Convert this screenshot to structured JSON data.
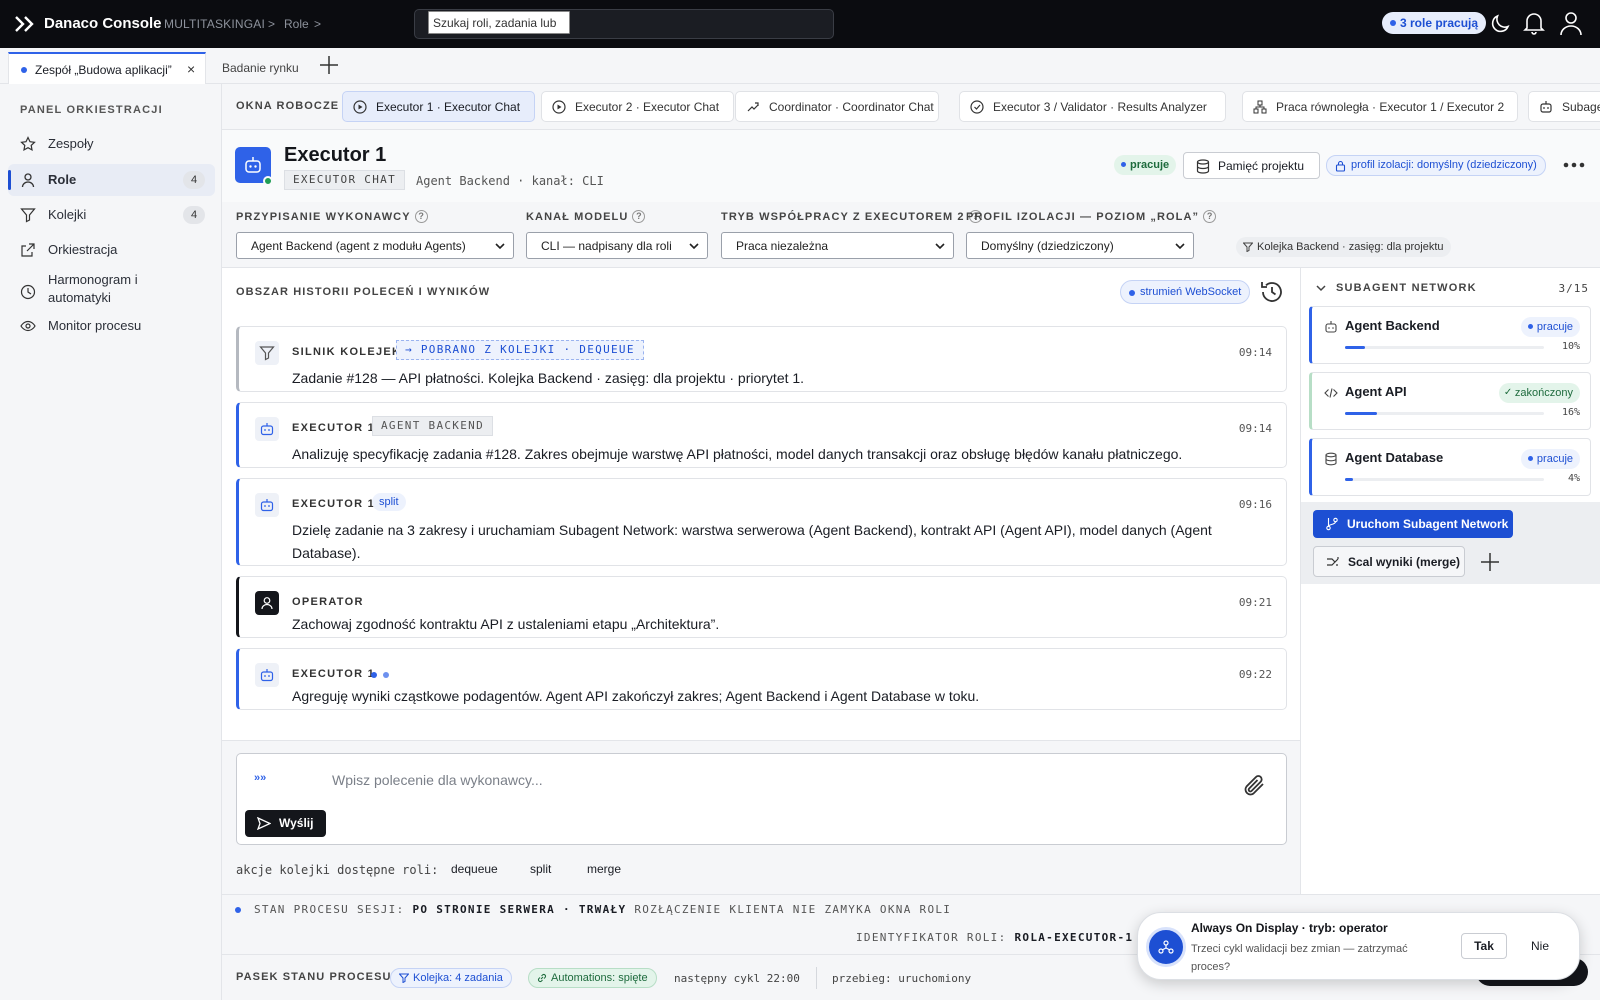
{
  "topbar": {
    "brand": "Danaco Console",
    "breadcrumb": [
      "MULTITASKINGAI",
      "Role"
    ],
    "breadcrumb_sep": ">",
    "search_value": "Szukaj roli, zadania lub",
    "roles_working": "3 role pracują"
  },
  "tabs": [
    {
      "label": "Zespół „Budowa aplikacji”",
      "active": true,
      "close": "×"
    },
    {
      "label": "Badanie rynku",
      "active": false
    }
  ],
  "sidebar": {
    "title": "PANEL ORKIESTRACJI",
    "items": [
      {
        "label": "Zespoły",
        "icon": "star-icon"
      },
      {
        "label": "Role",
        "icon": "user-icon",
        "badge": "4",
        "active": true
      },
      {
        "label": "Kolejki",
        "icon": "filter-icon",
        "badge": "4"
      },
      {
        "label": "Orkiestracja",
        "icon": "external-link-icon"
      },
      {
        "label": "Harmonogram i automatyki",
        "icon": "clock-icon"
      },
      {
        "label": "Monitor procesu",
        "icon": "eye-icon"
      }
    ]
  },
  "work_windows": {
    "title": "OKNA ROBOCZE",
    "items": [
      {
        "label": "Executor 1 · Executor Chat",
        "icon": "play-circle-icon",
        "active": true
      },
      {
        "label": "Executor 2 · Executor Chat",
        "icon": "play-circle-icon"
      },
      {
        "label": "Coordinator · Coordinator Chat",
        "icon": "route-icon"
      },
      {
        "label": "Executor 3 / Validator · Results Analyzer",
        "icon": "check-circle-icon"
      },
      {
        "label": "Praca równoległa · Executor 1 / Executor 2",
        "icon": "network-icon"
      },
      {
        "label": "Subage",
        "icon": "bot-icon"
      }
    ]
  },
  "executor": {
    "title": "Executor 1",
    "badge": "EXECUTOR CHAT",
    "subtitle": "Agent Backend · kanał: CLI",
    "status": "pracuje",
    "memory_button": "Pamięć projektu",
    "isolation_badge": "profil izolacji: domyślny (dziedziczony)",
    "more": "•••"
  },
  "config": {
    "assignment": {
      "label": "PRZYPISANIE WYKONAWCY",
      "value": "Agent Backend (agent z modułu Agents)"
    },
    "model_channel": {
      "label": "KANAŁ MODELU",
      "value": "CLI — nadpisany dla roli"
    },
    "collab_mode": {
      "label": "TRYB WSPÓŁPRACY Z EXECUTOREM 2",
      "value": "Praca niezależna"
    },
    "isolation": {
      "label": "PROFIL IZOLACJI — POZIOM „ROLA”",
      "value": "Domyślny (dziedziczony)"
    },
    "help": "?",
    "queue_scope": "Kolejka Backend · zasięg: dla projektu"
  },
  "history": {
    "title": "OBSZAR HISTORII POLECEŃ I WYNIKÓW",
    "stream_badge": "strumień WebSocket",
    "messages": [
      {
        "who": "SILNIK KOLEJEK",
        "tag": "→ POBRANO Z KOLEJKI · DEQUEUE",
        "time": "09:14",
        "text": "Zadanie #128 — API płatności. Kolejka Backend · zasięg: dla projektu · priorytet 1."
      },
      {
        "who": "EXECUTOR 1",
        "tag": "AGENT BACKEND",
        "time": "09:14",
        "text": "Analizuję specyfikację zadania #128. Zakres obejmuje warstwę API płatności, model danych transakcji oraz obsługę błędów kanału płatniczego."
      },
      {
        "who": "EXECUTOR 1",
        "tag": "split",
        "time": "09:16",
        "text": "Dzielę zadanie na 3 zakresy i uruchamiam Subagent Network: warstwa serwerowa (Agent Backend), kontrakt API (Agent API), model danych (Agent Database)."
      },
      {
        "who": "OPERATOR",
        "time": "09:21",
        "text": "Zachowaj zgodność kontraktu API z ustaleniami etapu „Architektura”."
      },
      {
        "who": "EXECUTOR 1",
        "time": "09:22",
        "text": "Agreguję wyniki cząstkowe podagentów. Agent API zakończył zakres; Agent Backend i Agent Database w toku."
      }
    ]
  },
  "composer": {
    "prefix": "»»",
    "placeholder": "Wpisz polecenie dla wykonawcy...",
    "send": "Wyślij",
    "actions_label": "akcje kolejki dostępne roli:",
    "actions": [
      "dequeue",
      "split",
      "merge"
    ]
  },
  "subagents": {
    "title": "SUBAGENT NETWORK",
    "count": "3/15",
    "agents": [
      {
        "name": "Agent Backend",
        "status": "pracuje",
        "state": "run",
        "progress": 10,
        "progress_label": "10%",
        "icon": "bot-icon"
      },
      {
        "name": "Agent API",
        "status": "zakończony",
        "state": "done",
        "progress": 16,
        "progress_label": "16%",
        "icon": "code-icon"
      },
      {
        "name": "Agent Database",
        "status": "pracuje",
        "state": "run",
        "progress": 4,
        "progress_label": "4%",
        "icon": "database-icon"
      }
    ],
    "run_button": "Uruchom Subagent Network",
    "merge_button": "Scal wyniki (merge)"
  },
  "session": {
    "label": "STAN PROCESU SESJI:",
    "value": "PO STRONIE SERWERA · TRWAŁY",
    "note": "ROZŁĄCZENIE KLIENTA NIE ZAMYKA OKNA ROLI",
    "roleid_label": "IDENTYFIKATOR ROLI:",
    "roleid_value": "ROLA-EXECUTOR-1"
  },
  "statusbar": {
    "title": "PASEK STANU PROCESU",
    "queue": "Kolejka: 4 zadania",
    "automations": "Automations: spięte",
    "next_cycle": "następny cykl 22:00",
    "run": "przebieg: uruchomiony"
  },
  "toast": {
    "title": "Always On Display · tryb: operator",
    "body": "Trzeci cykl walidacji bez zmian — zatrzymać proces?",
    "yes": "Tak",
    "no": "Nie"
  },
  "colors": {
    "accent": "#2f62e8",
    "topbar": "#0b0c10",
    "success": "#1e6b3d"
  }
}
